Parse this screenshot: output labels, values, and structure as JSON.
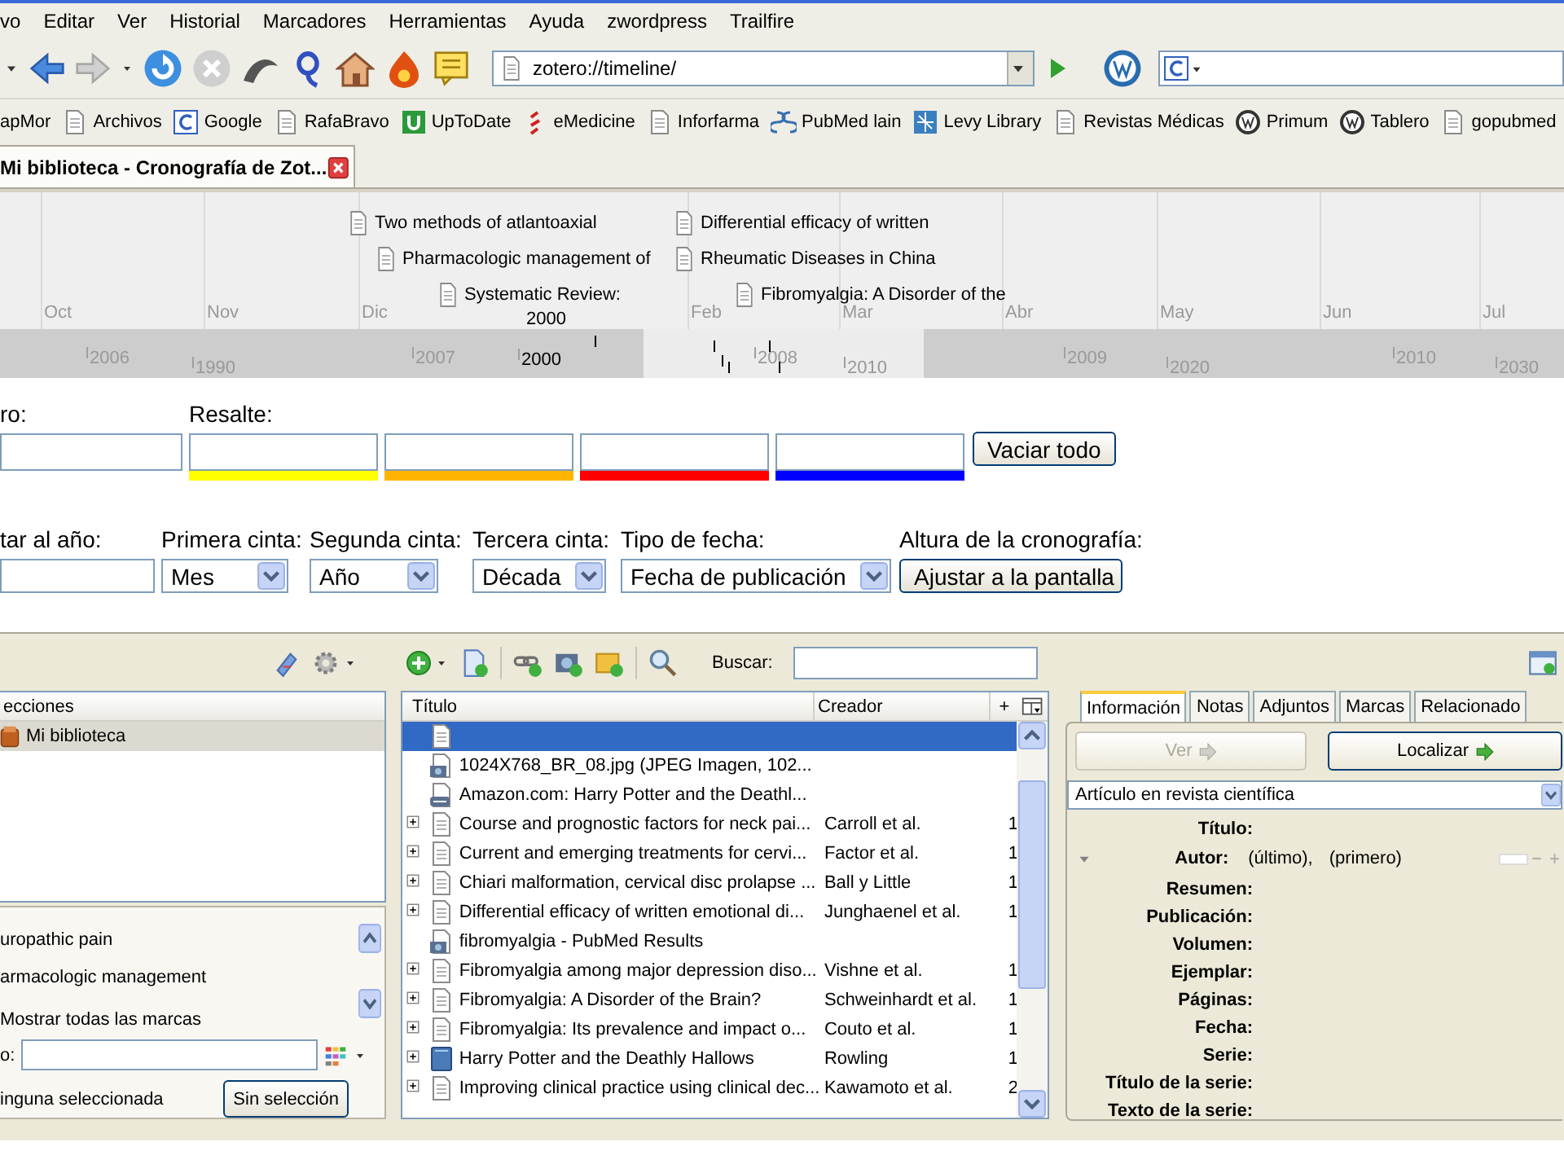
{
  "menu_bar": {
    "items": [
      "vo",
      "Editar",
      "Ver",
      "Historial",
      "Marcadores",
      "Herramientas",
      "Ayuda",
      "zwordpress",
      "Trailfire"
    ]
  },
  "navigation_toolbar": {
    "address": "zotero://timeline/"
  },
  "bookmarks": [
    {
      "label": "apMor",
      "kind": "none"
    },
    {
      "label": "Archivos",
      "kind": "page"
    },
    {
      "label": "Google",
      "kind": "search"
    },
    {
      "label": "RafaBravo",
      "kind": "page"
    },
    {
      "label": "UpToDate",
      "kind": "green"
    },
    {
      "label": "eMedicine",
      "kind": "red"
    },
    {
      "label": "Inforfarma",
      "kind": "page"
    },
    {
      "label": "PubMed lain",
      "kind": "wave"
    },
    {
      "label": "Levy Library",
      "kind": "grid"
    },
    {
      "label": "Revistas Médicas",
      "kind": "page"
    },
    {
      "label": "Primum",
      "kind": "wp"
    },
    {
      "label": "Tablero",
      "kind": "wp"
    },
    {
      "label": "gopubmed",
      "kind": "page"
    }
  ],
  "tabs": [
    {
      "label": "Mi biblioteca - Cronografía de Zot...",
      "selected": true
    }
  ],
  "timeline": {
    "months": [
      "Oct",
      "Nov",
      "Dic",
      "Feb",
      "Mar",
      "Abr",
      "May",
      "Jun",
      "Jul"
    ],
    "events": [
      "Two methods of atlantoaxial",
      "Pharmacologic management of",
      "Systematic Review:",
      "Differential efficacy of written",
      "Rheumatic Diseases in China",
      "Fibromyalgia: A Disorder of the"
    ],
    "overlay_year": "2000",
    "years": [
      "2006",
      "1990",
      "2007",
      "2000",
      "2008",
      "2010",
      "2009",
      "2020",
      "2010",
      "2030"
    ]
  },
  "filters": {
    "filter_label": "ro:",
    "highlight_label": "Resalte:",
    "highlights": [
      {
        "color": "#ffff00"
      },
      {
        "color": "#ffb400"
      },
      {
        "color": "#ff0000"
      },
      {
        "color": "#0000ff"
      }
    ],
    "clear_button": "Vaciar todo"
  },
  "controls": [
    {
      "label": "tar al año:",
      "kind": "input"
    },
    {
      "label": "Primera cinta:",
      "kind": "select",
      "value": "Mes"
    },
    {
      "label": "Segunda cinta:",
      "kind": "select",
      "value": "Año"
    },
    {
      "label": "Tercera cinta:",
      "kind": "select",
      "value": "Década"
    },
    {
      "label": "Tipo de fecha:",
      "kind": "select",
      "value": "Fecha de publicación"
    },
    {
      "label": "Altura de la cronografía:",
      "kind": "button",
      "value": "Ajustar a la pantalla"
    }
  ],
  "collections": {
    "header": "ecciones",
    "items": [
      {
        "label": "Mi biblioteca",
        "selected": true
      }
    ]
  },
  "tag_selector": {
    "tags": [
      "uropathic pain",
      "armacologic management"
    ],
    "show_all": "Mostrar todas las marcas",
    "filter_label": "o:",
    "selection_status": "inguna seleccionada",
    "deselect_button": "Sin selección"
  },
  "items_toolbar": {
    "search_label": "Buscar:"
  },
  "items": {
    "columns": [
      "Título",
      "Creador",
      "+"
    ],
    "rows": [
      {
        "kind": "article",
        "expandable": false,
        "selected": true
      },
      {
        "kind": "image",
        "expandable": false,
        "selected": false,
        "title": "1024X768_BR_08.jpg (JPEG Imagen, 102..."
      },
      {
        "kind": "link",
        "expandable": false,
        "selected": false,
        "title": "Amazon.com: Harry Potter and the Deathl..."
      },
      {
        "kind": "article",
        "expandable": true,
        "selected": false,
        "title": "Course and prognostic factors for neck pai...",
        "creator": "Carroll et al.",
        "count": "1"
      },
      {
        "kind": "article",
        "expandable": true,
        "selected": false,
        "title": "Current and emerging treatments for cervi...",
        "creator": "Factor et al.",
        "count": "1"
      },
      {
        "kind": "article",
        "expandable": true,
        "selected": false,
        "title": "Chiari malformation, cervical disc prolapse ...",
        "creator": "Ball y Little",
        "count": "1"
      },
      {
        "kind": "article",
        "expandable": true,
        "selected": false,
        "title": "Differential efficacy of written emotional di...",
        "creator": "Junghaenel et al.",
        "count": "1"
      },
      {
        "kind": "image",
        "expandable": false,
        "selected": false,
        "title": "fibromyalgia - PubMed Results"
      },
      {
        "kind": "article",
        "expandable": true,
        "selected": false,
        "title": "Fibromyalgia among major depression diso...",
        "creator": "Vishne et al.",
        "count": "1"
      },
      {
        "kind": "article",
        "expandable": true,
        "selected": false,
        "title": "Fibromyalgia: A Disorder of the Brain?",
        "creator": "Schweinhardt et al.",
        "count": "1"
      },
      {
        "kind": "article",
        "expandable": true,
        "selected": false,
        "title": "Fibromyalgia: Its prevalence and impact o...",
        "creator": "Couto et al.",
        "count": "1"
      },
      {
        "kind": "book",
        "expandable": true,
        "selected": false,
        "title": "Harry Potter and the Deathly Hallows",
        "creator": "Rowling",
        "count": "1"
      },
      {
        "kind": "article",
        "expandable": true,
        "selected": false,
        "title": "Improving clinical practice using clinical dec...",
        "creator": "Kawamoto et al.",
        "count": "2"
      }
    ]
  },
  "item_pane": {
    "tabs": [
      {
        "label": "Información",
        "selected": true
      },
      {
        "label": "Notas",
        "selected": false
      },
      {
        "label": "Adjuntos",
        "selected": false
      },
      {
        "label": "Marcas",
        "selected": false
      },
      {
        "label": "Relacionado",
        "selected": false
      }
    ],
    "buttons": [
      {
        "label": "Ver",
        "disabled": true
      },
      {
        "label": "Localizar",
        "disabled": false
      }
    ],
    "item_type": "Artículo en revista científica",
    "fields": [
      {
        "label": "Título:",
        "kind": "text"
      },
      {
        "label": "Autor:",
        "kind": "creator",
        "last": "(último),",
        "first": "(primero)"
      },
      {
        "label": "Resumen:",
        "kind": "text"
      },
      {
        "label": "Publicación:",
        "kind": "text"
      },
      {
        "label": "Volumen:",
        "kind": "text"
      },
      {
        "label": "Ejemplar:",
        "kind": "text"
      },
      {
        "label": "Páginas:",
        "kind": "text"
      },
      {
        "label": "Fecha:",
        "kind": "text"
      },
      {
        "label": "Serie:",
        "kind": "text"
      },
      {
        "label": "Título de la serie:",
        "kind": "text"
      },
      {
        "label": "Texto de la serie:",
        "kind": "text"
      }
    ]
  }
}
